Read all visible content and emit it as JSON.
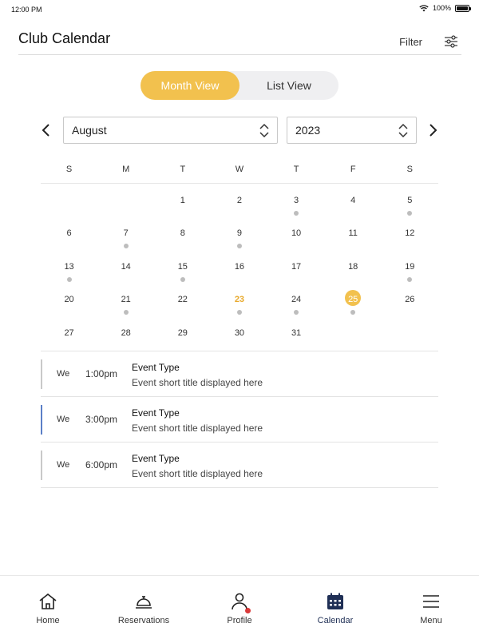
{
  "status": {
    "time": "12:00 PM",
    "battery": "100%"
  },
  "header": {
    "title": "Club Calendar",
    "filter_label": "Filter"
  },
  "view_toggle": {
    "month": "Month View",
    "list": "List View",
    "active": "month"
  },
  "date_selector": {
    "month": "August",
    "year": "2023"
  },
  "weekdays": [
    "S",
    "M",
    "T",
    "W",
    "T",
    "F",
    "S"
  ],
  "calendar": {
    "weeks": [
      [
        {
          "d": ""
        },
        {
          "d": ""
        },
        {
          "d": "1"
        },
        {
          "d": "2"
        },
        {
          "d": "3",
          "dot": true
        },
        {
          "d": "4"
        },
        {
          "d": "5",
          "dot": true
        }
      ],
      [
        {
          "d": "6"
        },
        {
          "d": "7",
          "dot": true
        },
        {
          "d": "8"
        },
        {
          "d": "9",
          "dot": true
        },
        {
          "d": "10"
        },
        {
          "d": "11"
        },
        {
          "d": "12"
        }
      ],
      [
        {
          "d": "13",
          "dot": true
        },
        {
          "d": "14"
        },
        {
          "d": "15",
          "dot": true
        },
        {
          "d": "16"
        },
        {
          "d": "17"
        },
        {
          "d": "18"
        },
        {
          "d": "19",
          "dot": true
        }
      ],
      [
        {
          "d": "20"
        },
        {
          "d": "21",
          "dot": true
        },
        {
          "d": "22"
        },
        {
          "d": "23",
          "dot": true,
          "today": true
        },
        {
          "d": "24",
          "dot": true
        },
        {
          "d": "25",
          "dot": true,
          "selected": true
        },
        {
          "d": "26"
        }
      ],
      [
        {
          "d": "27"
        },
        {
          "d": "28"
        },
        {
          "d": "29"
        },
        {
          "d": "30"
        },
        {
          "d": "31"
        },
        {
          "d": ""
        },
        {
          "d": ""
        }
      ]
    ]
  },
  "events": [
    {
      "day": "We",
      "time": "1:00pm",
      "type": "Event Type",
      "title": "Event short title displayed here",
      "accent": "#c9c9c9"
    },
    {
      "day": "We",
      "time": "3:00pm",
      "type": "Event Type",
      "title": "Event short title displayed here",
      "accent": "#5b7fc7"
    },
    {
      "day": "We",
      "time": "6:00pm",
      "type": "Event Type",
      "title": "Event short title displayed here",
      "accent": "#c9c9c9"
    }
  ],
  "tabbar": {
    "items": [
      {
        "label": "Home",
        "icon": "home-icon"
      },
      {
        "label": "Reservations",
        "icon": "service-bell-icon"
      },
      {
        "label": "Profile",
        "icon": "person-icon"
      },
      {
        "label": "Calendar",
        "icon": "calendar-icon"
      },
      {
        "label": "Menu",
        "icon": "hamburger-menu-icon"
      }
    ],
    "active": "Calendar"
  },
  "colors": {
    "accent": "#f2c14e",
    "nav_active": "#1f2f55",
    "dot": "#bdbdbd",
    "badge": "#d93a3a"
  }
}
